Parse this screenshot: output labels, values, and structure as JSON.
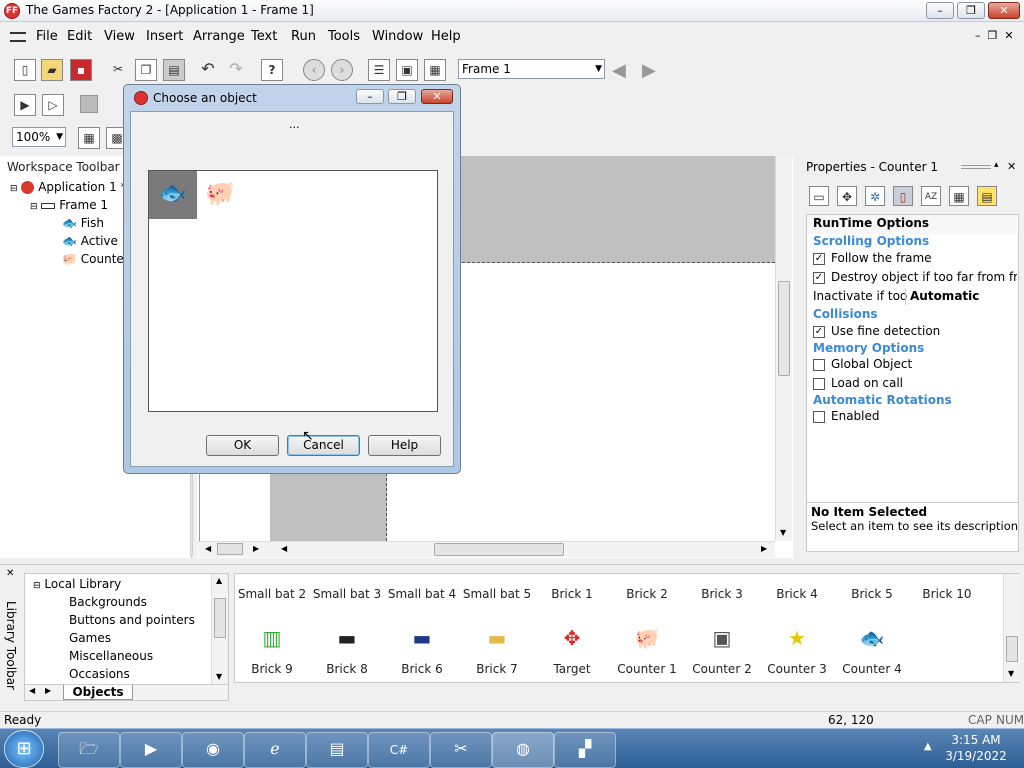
{
  "window": {
    "title": "The Games Factory 2 - [Application 1 - Frame 1]"
  },
  "menu": [
    "File",
    "Edit",
    "View",
    "Insert",
    "Arrange",
    "Text",
    "Run",
    "Tools",
    "Window",
    "Help"
  ],
  "toolbar": {
    "frame_select": "Frame 1",
    "zoom": "100%"
  },
  "workspace": {
    "title": "Workspace Toolbar",
    "items": [
      "Application 1 *",
      "Frame 1",
      "Fish",
      "Active",
      "Counter"
    ]
  },
  "dialog": {
    "title": "Choose an object",
    "caption": "...",
    "ok": "OK",
    "cancel": "Cancel",
    "help": "Help"
  },
  "properties": {
    "title": "Properties - Counter 1",
    "header": "RunTime Options",
    "sections": {
      "scrolling": "Scrolling Options",
      "collisions": "Collisions",
      "memory": "Memory Options",
      "rotations": "Automatic Rotations"
    },
    "rows": {
      "follow": "Follow the frame",
      "destroy": "Destroy object if too far from fra",
      "inactivate_label": "Inactivate if too",
      "inactivate_value": "Automatic",
      "fine": "Use fine detection",
      "global": "Global Object",
      "load": "Load on call",
      "enabled": "Enabled"
    },
    "desc_title": "No Item Selected",
    "desc_text": "Select an item to see its description"
  },
  "library": {
    "side_label": "Library Toolbar",
    "tree": [
      "Local Library",
      "Backgrounds",
      "Buttons and pointers",
      "Games",
      "Miscellaneous",
      "Occasions"
    ],
    "tab": "Objects",
    "row1": [
      "Small bat 2",
      "Small bat 3",
      "Small bat 4",
      "Small bat 5",
      "Brick 1",
      "Brick 2",
      "Brick 3",
      "Brick 4",
      "Brick 5",
      "Brick 10"
    ],
    "row2": [
      "Brick 9",
      "Brick 8",
      "Brick 6",
      "Brick 7",
      "Target",
      "Counter 1",
      "Counter 2",
      "Counter 3",
      "Counter 4"
    ]
  },
  "status": {
    "left": "Ready",
    "coords": "62, 120",
    "cap": "CAP",
    "num": "NUM"
  },
  "clock": {
    "time": "3:15 AM",
    "date": "3/19/2022"
  }
}
